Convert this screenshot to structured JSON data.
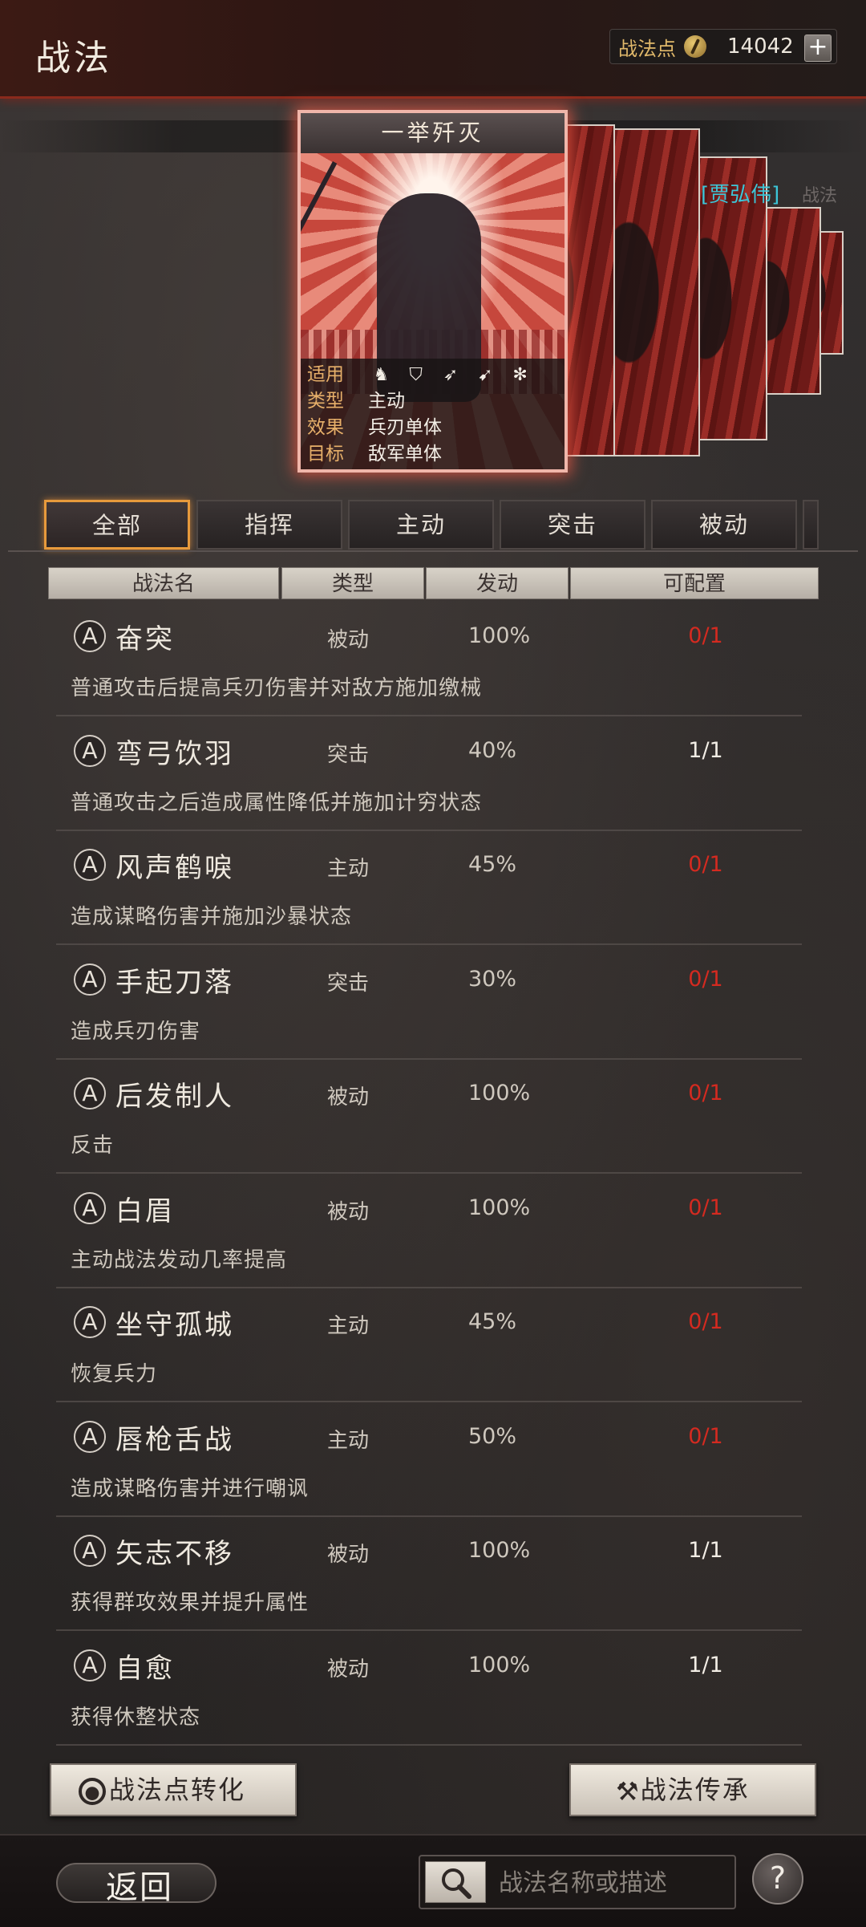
{
  "header": {
    "title": "战法",
    "points_label": "战法点",
    "points_value": "14042",
    "plus": "+"
  },
  "card": {
    "title": "一举歼灭",
    "general": "[贾弘伟]",
    "general_suffix": "战法",
    "rows": [
      {
        "key": "适用",
        "value": ""
      },
      {
        "key": "类型",
        "value": "主动"
      },
      {
        "key": "效果",
        "value": "兵刃单体"
      },
      {
        "key": "目标",
        "value": "敌军单体"
      }
    ],
    "unit_icons": [
      "cavalry-icon",
      "shield-icon",
      "bow-icon",
      "spear-icon",
      "siege-icon"
    ]
  },
  "tabs": [
    "全部",
    "指挥",
    "主动",
    "突击",
    "被动"
  ],
  "list_header": {
    "name": "战法名",
    "type": "类型",
    "rate": "发动",
    "config": "可配置"
  },
  "grade": "A",
  "skills": [
    {
      "name": "奋突",
      "type": "被动",
      "rate": "100%",
      "config": "0/1",
      "desc": "普通攻击后提高兵刃伤害并对敌方施加缴械"
    },
    {
      "name": "弯弓饮羽",
      "type": "突击",
      "rate": "40%",
      "config": "1/1",
      "desc": "普通攻击之后造成属性降低并施加计穷状态"
    },
    {
      "name": "风声鹤唳",
      "type": "主动",
      "rate": "45%",
      "config": "0/1",
      "desc": "造成谋略伤害并施加沙暴状态"
    },
    {
      "name": "手起刀落",
      "type": "突击",
      "rate": "30%",
      "config": "0/1",
      "desc": "造成兵刃伤害"
    },
    {
      "name": "后发制人",
      "type": "被动",
      "rate": "100%",
      "config": "0/1",
      "desc": "反击"
    },
    {
      "name": "白眉",
      "type": "被动",
      "rate": "100%",
      "config": "0/1",
      "desc": "主动战法发动几率提高"
    },
    {
      "name": "坐守孤城",
      "type": "主动",
      "rate": "45%",
      "config": "0/1",
      "desc": "恢复兵力"
    },
    {
      "name": "唇枪舌战",
      "type": "主动",
      "rate": "50%",
      "config": "0/1",
      "desc": "造成谋略伤害并进行嘲讽"
    },
    {
      "name": "矢志不移",
      "type": "被动",
      "rate": "100%",
      "config": "1/1",
      "desc": "获得群攻效果并提升属性"
    },
    {
      "name": "自愈",
      "type": "被动",
      "rate": "100%",
      "config": "1/1",
      "desc": "获得休整状态"
    }
  ],
  "buttons": {
    "convert": "战法点转化",
    "inherit": "战法传承",
    "back": "返回"
  },
  "search": {
    "placeholder": "战法名称或描述"
  },
  "help": "?",
  "colors": {
    "unavailable": "#d42a20",
    "available": "#f2ede5",
    "tab_active": "#e79a3c"
  }
}
